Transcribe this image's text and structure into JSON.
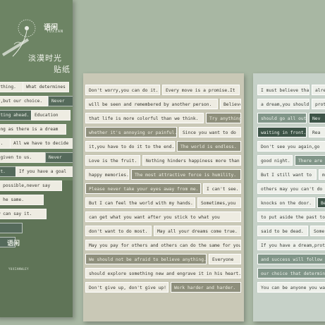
{
  "pack": {
    "brand": "语闲",
    "brand_en": "YUXIAN",
    "title_line1": "淡漠时光",
    "title_line2": "贴纸",
    "brand_lower": "语闲",
    "brand_lower_en": "YUXIANWLEY",
    "strips": [
      "nything.",
      "What determines",
      "ty,but our choice.",
      "Never",
      "aiting ahead.",
      "Education",
      "long as there is a dream",
      "ft.",
      "All we have to decide",
      "s given to us.",
      "Never",
      "ant.",
      "If you have a goal",
      "is possible,never say",
      "as he same.",
      "ow can say it.",
      "th",
      "ht"
    ]
  },
  "sheet_middle": {
    "strips": [
      "Don't worry,you can do it.",
      "Every move is a promise.It",
      "will be seen and remembered by another person.",
      "Believe",
      "that life is more colorful than we think.",
      "Try anything",
      "whether it's annoying or painful.",
      "Since you want to do",
      "it,you have to do it to the end.",
      "The world is endless.",
      "Love is the fruit.",
      "Nothing hinders happiness more than",
      "happy memories.",
      "The most attractive force is humility.",
      "Please never take your eyes away from me.",
      "I can't see.",
      "But I can feel the world with my hands.",
      "Sometimes,you",
      "can get what you want after you stick to what you",
      "don't want to do most.",
      "May all your dreams come true.",
      "May you pay for others and others can do the same for you.",
      "We should not be afraid to believe anything.",
      "Everyone",
      "should explore something new and engrave it in his heart.",
      "Don't give up, don't give up!",
      "Work harder and harder."
    ]
  },
  "sheet_right": {
    "strips": [
      "I must believe that",
      "alre",
      "a dream,you should",
      "prote",
      "should go all out.",
      "Nev",
      "waiting in front.",
      "Rea",
      "Don't see you again,go",
      "good night.",
      "There are",
      "But I still want to",
      "make",
      "others may you can't do",
      "knocks on the door.",
      "Beco",
      "to put aside the past to",
      "said to be dead.",
      "Some",
      "If you have a dream,prote",
      "and success will follow",
      "our choice that determine",
      "You can be anyone you wa"
    ]
  }
}
